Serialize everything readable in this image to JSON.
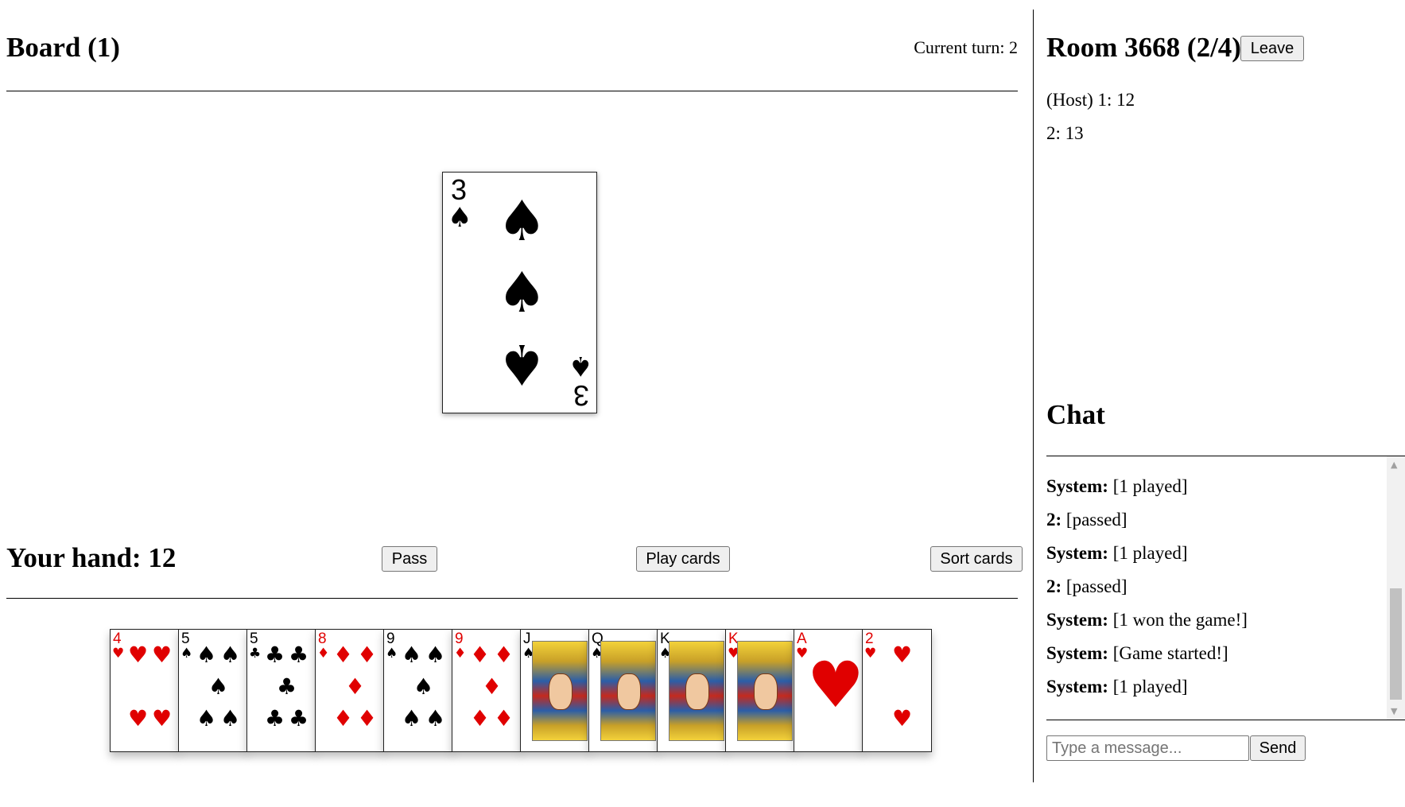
{
  "board": {
    "title": "Board (1)",
    "current_turn": "Current turn: 2",
    "card": {
      "rank": "3",
      "suit": "spades",
      "symbol": "♠",
      "color": "#000000"
    }
  },
  "hand": {
    "title": "Your hand: 12",
    "buttons": {
      "pass": "Pass",
      "play": "Play cards",
      "sort": "Sort cards"
    },
    "cards": [
      {
        "rank": "4",
        "suit": "hearts",
        "symbol": "♥",
        "color": "#e00000"
      },
      {
        "rank": "5",
        "suit": "spades",
        "symbol": "♠",
        "color": "#000000"
      },
      {
        "rank": "5",
        "suit": "clubs",
        "symbol": "♣",
        "color": "#000000"
      },
      {
        "rank": "8",
        "suit": "diamonds",
        "symbol": "♦",
        "color": "#e00000"
      },
      {
        "rank": "9",
        "suit": "spades",
        "symbol": "♠",
        "color": "#000000"
      },
      {
        "rank": "9",
        "suit": "diamonds",
        "symbol": "♦",
        "color": "#e00000"
      },
      {
        "rank": "J",
        "suit": "spades",
        "symbol": "♠",
        "color": "#000000"
      },
      {
        "rank": "Q",
        "suit": "spades",
        "symbol": "♠",
        "color": "#000000"
      },
      {
        "rank": "K",
        "suit": "spades",
        "symbol": "♠",
        "color": "#000000"
      },
      {
        "rank": "K",
        "suit": "hearts",
        "symbol": "♥",
        "color": "#e00000"
      },
      {
        "rank": "A",
        "suit": "hearts",
        "symbol": "♥",
        "color": "#e00000"
      },
      {
        "rank": "2",
        "suit": "hearts",
        "symbol": "♥",
        "color": "#e00000"
      }
    ]
  },
  "room": {
    "title": "Room 3668 (2/4)",
    "leave_label": "Leave",
    "players": [
      "(Host) 1: 12",
      "2: 13"
    ]
  },
  "chat": {
    "title": "Chat",
    "messages": [
      {
        "author": "System:",
        "text": "[1 played]"
      },
      {
        "author": "2:",
        "text": "[passed]"
      },
      {
        "author": "System:",
        "text": "[1 played]"
      },
      {
        "author": "2:",
        "text": "[passed]"
      },
      {
        "author": "System:",
        "text": "[1 won the game!]"
      },
      {
        "author": "System:",
        "text": "[Game started!]"
      },
      {
        "author": "System:",
        "text": "[1 played]"
      }
    ],
    "input_placeholder": "Type a message...",
    "send_label": "Send"
  }
}
